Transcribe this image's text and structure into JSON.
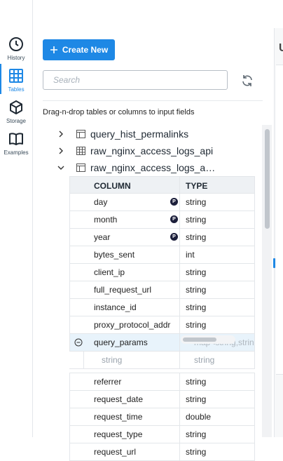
{
  "nav": {
    "items": [
      {
        "label": "History",
        "icon": "clock-icon"
      },
      {
        "label": "Tables",
        "icon": "grid-icon",
        "active": true
      },
      {
        "label": "Storage",
        "icon": "cube-icon"
      },
      {
        "label": "Examples",
        "icon": "book-icon"
      }
    ]
  },
  "panel": {
    "create_label": "Create New",
    "search_placeholder": "Search",
    "hint": "Drag-n-drop tables or columns to input fields"
  },
  "tree": {
    "tables": [
      {
        "name": "query_hist_permalinks",
        "expanded": false,
        "icon": "table-icon"
      },
      {
        "name": "raw_nginx_access_logs_api",
        "expanded": false,
        "icon": "partitioned-table-icon"
      },
      {
        "name": "raw_nginx_access_logs_a…",
        "expanded": true,
        "icon": "table-icon"
      }
    ]
  },
  "columns": {
    "header": {
      "column": "COLUMN",
      "type": "TYPE"
    },
    "rows": [
      {
        "name": "day",
        "type": "string",
        "partition": true
      },
      {
        "name": "month",
        "type": "string",
        "partition": true
      },
      {
        "name": "year",
        "type": "string",
        "partition": true
      },
      {
        "name": "bytes_sent",
        "type": "int",
        "partition": false
      },
      {
        "name": "client_ip",
        "type": "string",
        "partition": false
      },
      {
        "name": "full_request_url",
        "type": "string",
        "partition": false
      },
      {
        "name": "instance_id",
        "type": "string",
        "partition": false
      },
      {
        "name": "proxy_protocol_addr",
        "type": "string",
        "partition": false
      },
      {
        "name": "query_params",
        "type": "map<string,string>",
        "partition": false,
        "selected": true,
        "expanded": true
      },
      {
        "name": "referrer",
        "type": "string",
        "partition": false
      },
      {
        "name": "request_date",
        "type": "string",
        "partition": false
      },
      {
        "name": "request_time",
        "type": "double",
        "partition": false
      },
      {
        "name": "request_type",
        "type": "string",
        "partition": false
      },
      {
        "name": "request_url",
        "type": "string",
        "partition": false
      }
    ],
    "query_params_sub": {
      "key_type": "string",
      "value_type": "string"
    },
    "partition_badge": "P"
  },
  "right_panel": {
    "letter": "U"
  },
  "colors": {
    "accent": "#1e88e5",
    "badge": "#1c1f3b",
    "header_bg": "#eef1f4"
  }
}
